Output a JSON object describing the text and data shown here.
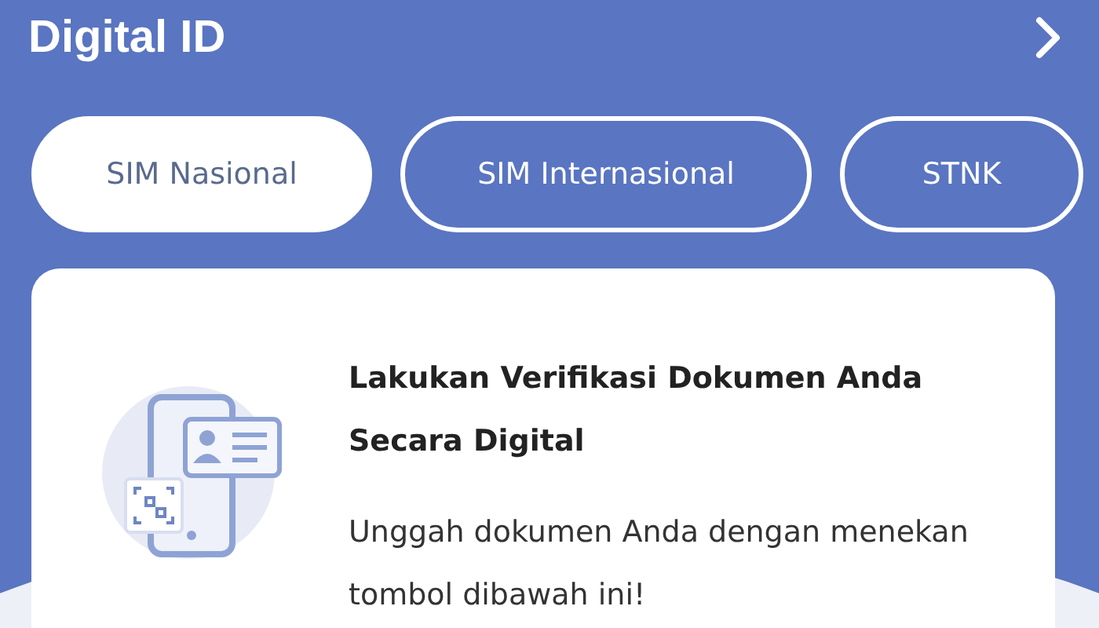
{
  "header": {
    "title": "Digital ID"
  },
  "tabs": [
    {
      "label": "SIM Nasional",
      "selected": true
    },
    {
      "label": "SIM Internasional",
      "selected": false
    },
    {
      "label": "STNK",
      "selected": false
    }
  ],
  "card": {
    "heading": "Lakukan Verifikasi Dokumen Anda Secara Digital",
    "body": "Unggah dokumen Anda dengan menekan tombol dibawah ini!"
  }
}
